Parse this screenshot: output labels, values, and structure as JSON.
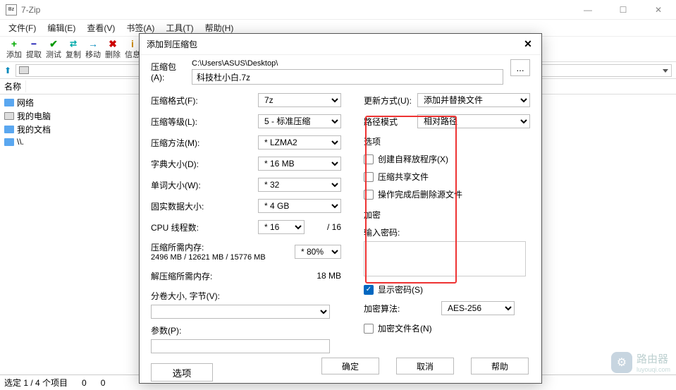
{
  "app": {
    "title": "7-Zip"
  },
  "menu": [
    "文件(F)",
    "编辑(E)",
    "查看(V)",
    "书签(A)",
    "工具(T)",
    "帮助(H)"
  ],
  "toolbar": [
    "添加",
    "提取",
    "测试",
    "复制",
    "移动",
    "删除",
    "信息"
  ],
  "columns": {
    "name": "名称"
  },
  "files": [
    "网络",
    "我的电脑",
    "我的文档",
    "\\\\."
  ],
  "status": {
    "left": "选定 1 / 4 个项目",
    "c1": "0",
    "c2": "0"
  },
  "dialog": {
    "title": "添加到压缩包",
    "archive_label": "压缩包(A):",
    "archive_path": "C:\\Users\\ASUS\\Desktop\\",
    "archive_name": "科技杜小白.7z",
    "browse": "...",
    "left": {
      "format": "压缩格式(F):",
      "format_v": "7z",
      "level": "压缩等级(L):",
      "level_v": "5 - 标准压缩",
      "method": "压缩方法(M):",
      "method_v": "* LZMA2",
      "dict": "字典大小(D):",
      "dict_v": "* 16 MB",
      "word": "单词大小(W):",
      "word_v": "* 32",
      "solid": "固实数据大小:",
      "solid_v": "* 4 GB",
      "threads": "CPU 线程数:",
      "threads_v": "* 16",
      "threads_max": "/ 16",
      "mem_c": "压缩所需内存:",
      "mem_c_v": "2496 MB / 12621 MB / 15776 MB",
      "mem_pct": "* 80%",
      "mem_d": "解压缩所需内存:",
      "mem_d_v": "18 MB",
      "split": "分卷大小, 字节(V):",
      "params": "参数(P):",
      "options": "选项"
    },
    "right": {
      "update": "更新方式(U):",
      "update_v": "添加并替换文件",
      "path": "路径模式",
      "path_v": "相对路径",
      "opts_title": "选项",
      "sfx": "创建自释放程序(X)",
      "share": "压缩共享文件",
      "delafter": "操作完成后删除源文件",
      "enc_title": "加密",
      "pw_label": "输入密码:",
      "show_pw": "显示密码(S)",
      "enc_method": "加密算法:",
      "enc_method_v": "AES-256",
      "enc_names": "加密文件名(N)"
    },
    "buttons": {
      "ok": "确定",
      "cancel": "取消",
      "help": "帮助"
    }
  },
  "watermark": {
    "text": "路由器",
    "sub": "luyouqi.com"
  }
}
